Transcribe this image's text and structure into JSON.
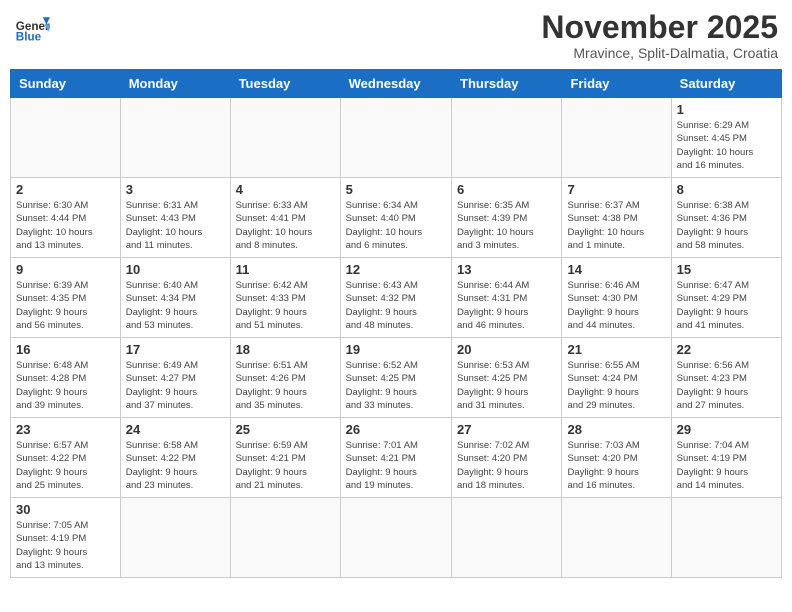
{
  "header": {
    "logo_general": "General",
    "logo_blue": "Blue",
    "month_title": "November 2025",
    "location": "Mravince, Split-Dalmatia, Croatia"
  },
  "weekdays": [
    "Sunday",
    "Monday",
    "Tuesday",
    "Wednesday",
    "Thursday",
    "Friday",
    "Saturday"
  ],
  "weeks": [
    [
      {
        "day": "",
        "info": ""
      },
      {
        "day": "",
        "info": ""
      },
      {
        "day": "",
        "info": ""
      },
      {
        "day": "",
        "info": ""
      },
      {
        "day": "",
        "info": ""
      },
      {
        "day": "",
        "info": ""
      },
      {
        "day": "1",
        "info": "Sunrise: 6:29 AM\nSunset: 4:45 PM\nDaylight: 10 hours\nand 16 minutes."
      }
    ],
    [
      {
        "day": "2",
        "info": "Sunrise: 6:30 AM\nSunset: 4:44 PM\nDaylight: 10 hours\nand 13 minutes."
      },
      {
        "day": "3",
        "info": "Sunrise: 6:31 AM\nSunset: 4:43 PM\nDaylight: 10 hours\nand 11 minutes."
      },
      {
        "day": "4",
        "info": "Sunrise: 6:33 AM\nSunset: 4:41 PM\nDaylight: 10 hours\nand 8 minutes."
      },
      {
        "day": "5",
        "info": "Sunrise: 6:34 AM\nSunset: 4:40 PM\nDaylight: 10 hours\nand 6 minutes."
      },
      {
        "day": "6",
        "info": "Sunrise: 6:35 AM\nSunset: 4:39 PM\nDaylight: 10 hours\nand 3 minutes."
      },
      {
        "day": "7",
        "info": "Sunrise: 6:37 AM\nSunset: 4:38 PM\nDaylight: 10 hours\nand 1 minute."
      },
      {
        "day": "8",
        "info": "Sunrise: 6:38 AM\nSunset: 4:36 PM\nDaylight: 9 hours\nand 58 minutes."
      }
    ],
    [
      {
        "day": "9",
        "info": "Sunrise: 6:39 AM\nSunset: 4:35 PM\nDaylight: 9 hours\nand 56 minutes."
      },
      {
        "day": "10",
        "info": "Sunrise: 6:40 AM\nSunset: 4:34 PM\nDaylight: 9 hours\nand 53 minutes."
      },
      {
        "day": "11",
        "info": "Sunrise: 6:42 AM\nSunset: 4:33 PM\nDaylight: 9 hours\nand 51 minutes."
      },
      {
        "day": "12",
        "info": "Sunrise: 6:43 AM\nSunset: 4:32 PM\nDaylight: 9 hours\nand 48 minutes."
      },
      {
        "day": "13",
        "info": "Sunrise: 6:44 AM\nSunset: 4:31 PM\nDaylight: 9 hours\nand 46 minutes."
      },
      {
        "day": "14",
        "info": "Sunrise: 6:46 AM\nSunset: 4:30 PM\nDaylight: 9 hours\nand 44 minutes."
      },
      {
        "day": "15",
        "info": "Sunrise: 6:47 AM\nSunset: 4:29 PM\nDaylight: 9 hours\nand 41 minutes."
      }
    ],
    [
      {
        "day": "16",
        "info": "Sunrise: 6:48 AM\nSunset: 4:28 PM\nDaylight: 9 hours\nand 39 minutes."
      },
      {
        "day": "17",
        "info": "Sunrise: 6:49 AM\nSunset: 4:27 PM\nDaylight: 9 hours\nand 37 minutes."
      },
      {
        "day": "18",
        "info": "Sunrise: 6:51 AM\nSunset: 4:26 PM\nDaylight: 9 hours\nand 35 minutes."
      },
      {
        "day": "19",
        "info": "Sunrise: 6:52 AM\nSunset: 4:25 PM\nDaylight: 9 hours\nand 33 minutes."
      },
      {
        "day": "20",
        "info": "Sunrise: 6:53 AM\nSunset: 4:25 PM\nDaylight: 9 hours\nand 31 minutes."
      },
      {
        "day": "21",
        "info": "Sunrise: 6:55 AM\nSunset: 4:24 PM\nDaylight: 9 hours\nand 29 minutes."
      },
      {
        "day": "22",
        "info": "Sunrise: 6:56 AM\nSunset: 4:23 PM\nDaylight: 9 hours\nand 27 minutes."
      }
    ],
    [
      {
        "day": "23",
        "info": "Sunrise: 6:57 AM\nSunset: 4:22 PM\nDaylight: 9 hours\nand 25 minutes."
      },
      {
        "day": "24",
        "info": "Sunrise: 6:58 AM\nSunset: 4:22 PM\nDaylight: 9 hours\nand 23 minutes."
      },
      {
        "day": "25",
        "info": "Sunrise: 6:59 AM\nSunset: 4:21 PM\nDaylight: 9 hours\nand 21 minutes."
      },
      {
        "day": "26",
        "info": "Sunrise: 7:01 AM\nSunset: 4:21 PM\nDaylight: 9 hours\nand 19 minutes."
      },
      {
        "day": "27",
        "info": "Sunrise: 7:02 AM\nSunset: 4:20 PM\nDaylight: 9 hours\nand 18 minutes."
      },
      {
        "day": "28",
        "info": "Sunrise: 7:03 AM\nSunset: 4:20 PM\nDaylight: 9 hours\nand 16 minutes."
      },
      {
        "day": "29",
        "info": "Sunrise: 7:04 AM\nSunset: 4:19 PM\nDaylight: 9 hours\nand 14 minutes."
      }
    ],
    [
      {
        "day": "30",
        "info": "Sunrise: 7:05 AM\nSunset: 4:19 PM\nDaylight: 9 hours\nand 13 minutes."
      },
      {
        "day": "",
        "info": ""
      },
      {
        "day": "",
        "info": ""
      },
      {
        "day": "",
        "info": ""
      },
      {
        "day": "",
        "info": ""
      },
      {
        "day": "",
        "info": ""
      },
      {
        "day": "",
        "info": ""
      }
    ]
  ]
}
